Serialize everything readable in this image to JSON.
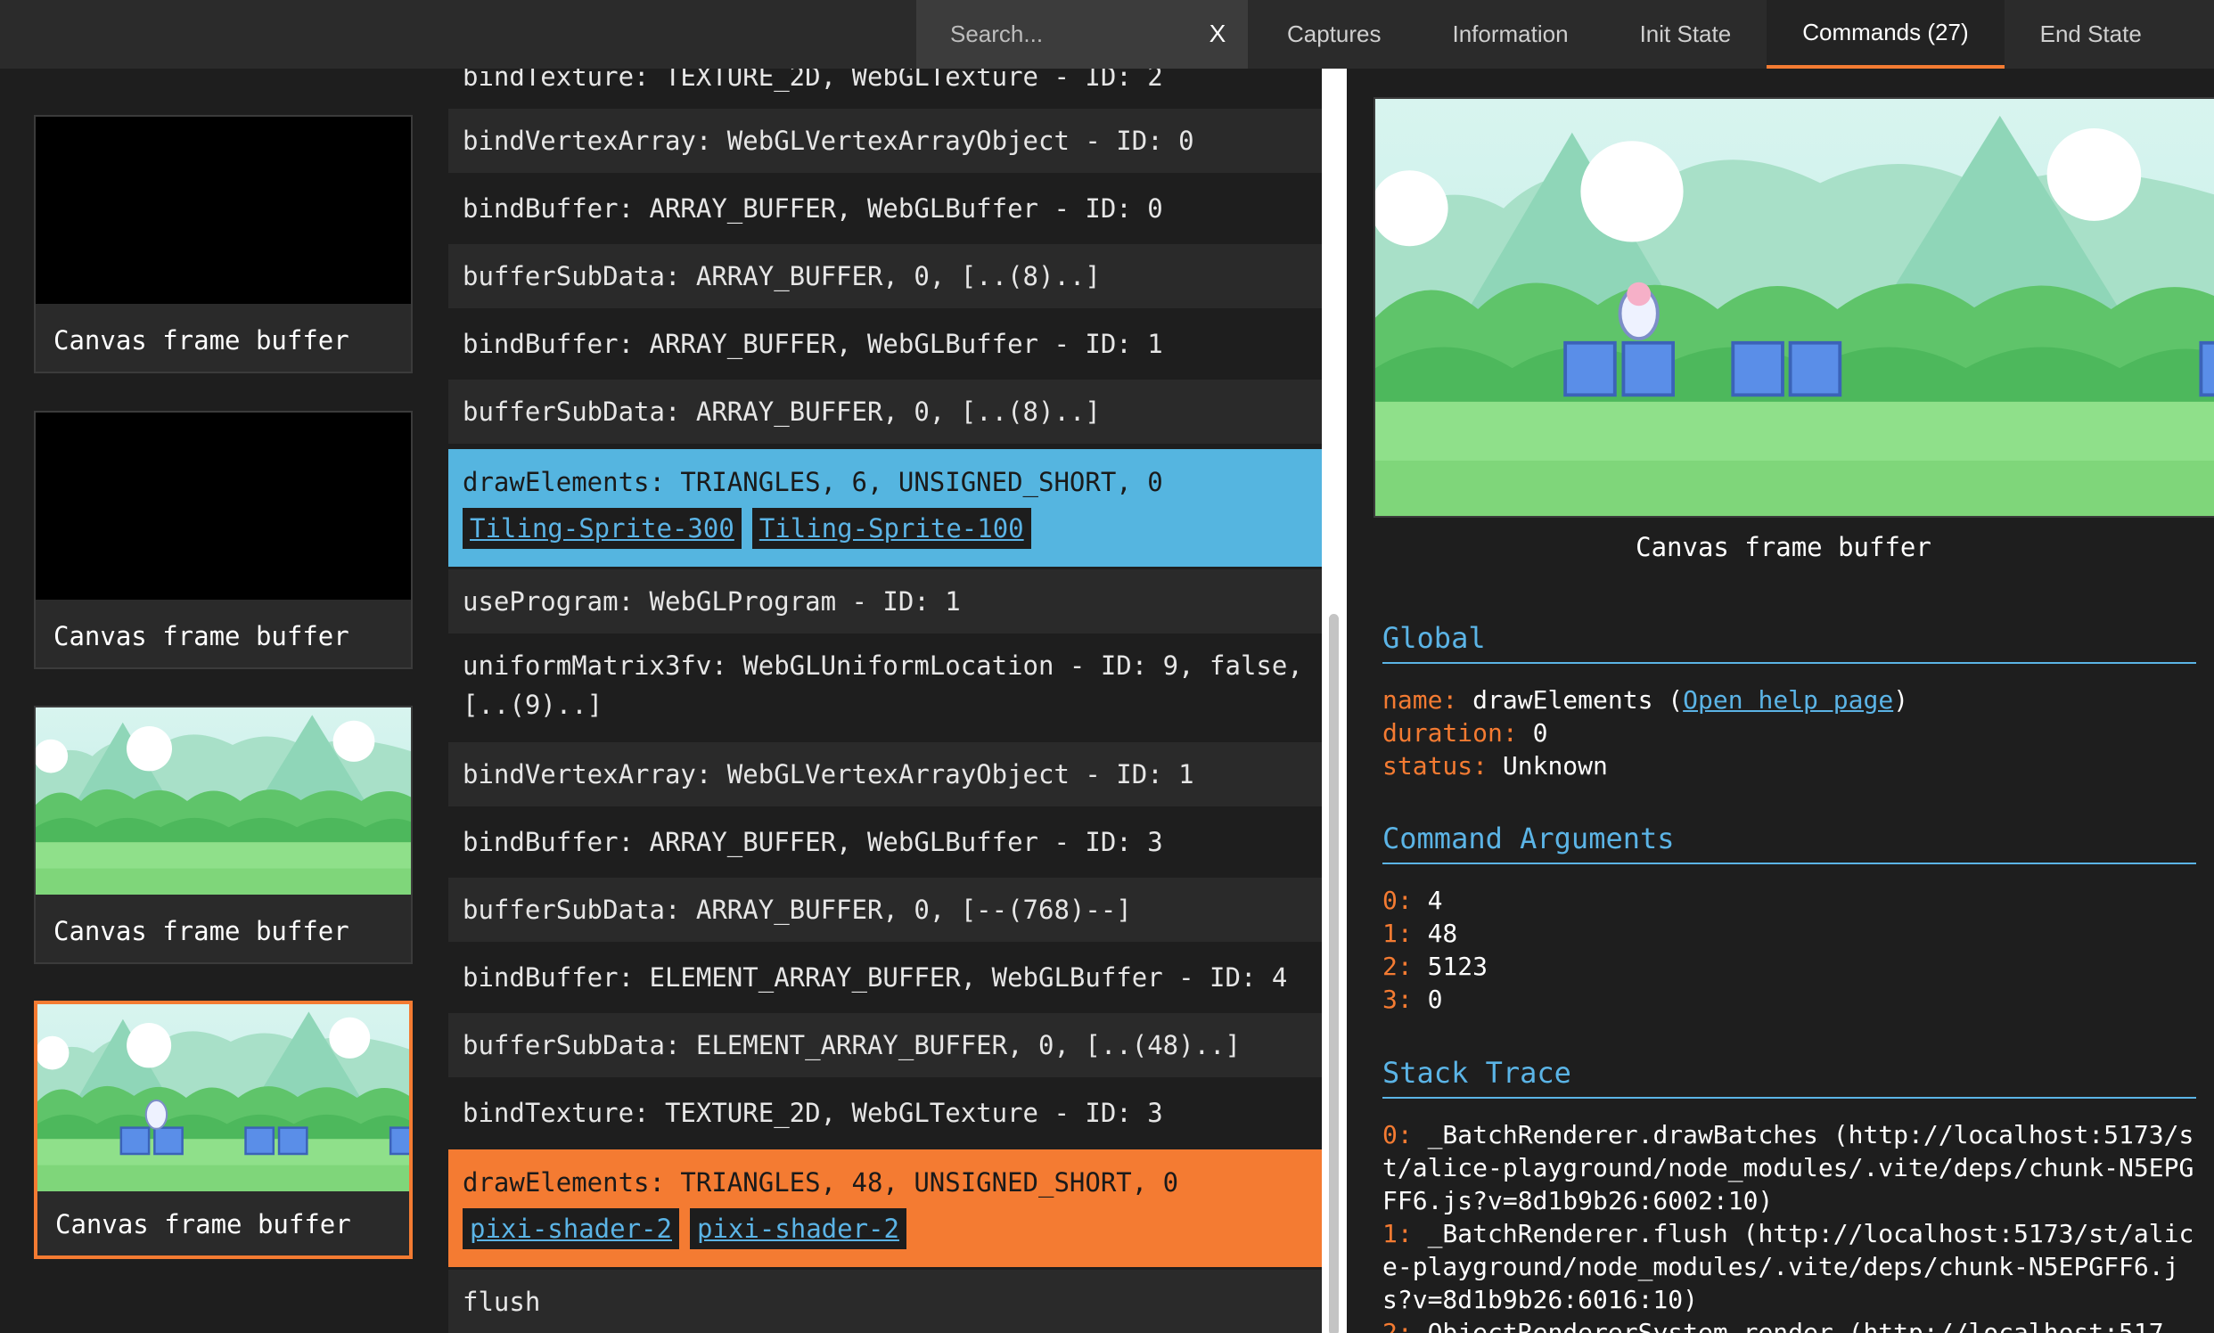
{
  "search": {
    "placeholder": "Search...",
    "close_label": "X"
  },
  "tabs": [
    {
      "label": "Captures"
    },
    {
      "label": "Information"
    },
    {
      "label": "Init State"
    },
    {
      "label": "Commands (27)"
    },
    {
      "label": "End State"
    }
  ],
  "thumbnails": [
    {
      "caption": "Canvas frame buffer"
    },
    {
      "caption": "Canvas frame buffer"
    },
    {
      "caption": "Canvas frame buffer"
    },
    {
      "caption": "Canvas frame buffer"
    }
  ],
  "commands": [
    {
      "text": "bindTexture: TEXTURE_2D, WebGLTexture - ID: 2"
    },
    {
      "text": "bindVertexArray: WebGLVertexArrayObject - ID: 0"
    },
    {
      "text": "bindBuffer: ARRAY_BUFFER, WebGLBuffer - ID: 0"
    },
    {
      "text": "bufferSubData: ARRAY_BUFFER, 0, [..(8)..]"
    },
    {
      "text": "bindBuffer: ARRAY_BUFFER, WebGLBuffer - ID: 1"
    },
    {
      "text": "bufferSubData: ARRAY_BUFFER, 0, [..(8)..]"
    },
    {
      "text": "drawElements: TRIANGLES, 6, UNSIGNED_SHORT, 0",
      "tags": [
        "Tiling-Sprite-300",
        "Tiling-Sprite-100"
      ]
    },
    {
      "text": "useProgram: WebGLProgram - ID: 1"
    },
    {
      "text": "uniformMatrix3fv: WebGLUniformLocation - ID: 9, false, [..(9)..]"
    },
    {
      "text": "bindVertexArray: WebGLVertexArrayObject - ID: 1"
    },
    {
      "text": "bindBuffer: ARRAY_BUFFER, WebGLBuffer - ID: 3"
    },
    {
      "text": "bufferSubData: ARRAY_BUFFER, 0, [--(768)--]"
    },
    {
      "text": "bindBuffer: ELEMENT_ARRAY_BUFFER, WebGLBuffer - ID: 4"
    },
    {
      "text": "bufferSubData: ELEMENT_ARRAY_BUFFER, 0, [..(48)..]"
    },
    {
      "text": "bindTexture: TEXTURE_2D, WebGLTexture - ID: 3"
    },
    {
      "text": "drawElements: TRIANGLES, 48, UNSIGNED_SHORT, 0",
      "tags": [
        "pixi-shader-2",
        "pixi-shader-2"
      ]
    },
    {
      "text": "flush"
    }
  ],
  "detail": {
    "preview_caption": "Canvas frame buffer",
    "global": {
      "title": "Global",
      "name_key": "name:",
      "name_value": "drawElements (",
      "help_link": "Open help page",
      "name_close": ")",
      "duration_key": "duration:",
      "duration_value": "0",
      "status_key": "status:",
      "status_value": "Unknown"
    },
    "arguments": {
      "title": "Command Arguments",
      "items": [
        {
          "key": "0:",
          "value": "4"
        },
        {
          "key": "1:",
          "value": "48"
        },
        {
          "key": "2:",
          "value": "5123"
        },
        {
          "key": "3:",
          "value": "0"
        }
      ]
    },
    "stack": {
      "title": "Stack Trace",
      "items": [
        {
          "key": "0:",
          "value": "_BatchRenderer.drawBatches (http://localhost:5173/st/alice-playground/node_modules/.vite/deps/chunk-N5EPGFF6.js?v=8d1b9b26:6002:10)"
        },
        {
          "key": "1:",
          "value": "_BatchRenderer.flush (http://localhost:5173/st/alice-playground/node_modules/.vite/deps/chunk-N5EPGFF6.js?v=8d1b9b26:6016:10)"
        },
        {
          "key": "2:",
          "value": "ObjectRendererSystem.render (http://localhost:517"
        }
      ]
    }
  },
  "colors": {
    "accent_orange": "#f47b32",
    "accent_blue": "#55b5e0",
    "link_blue": "#5bb4e6"
  }
}
